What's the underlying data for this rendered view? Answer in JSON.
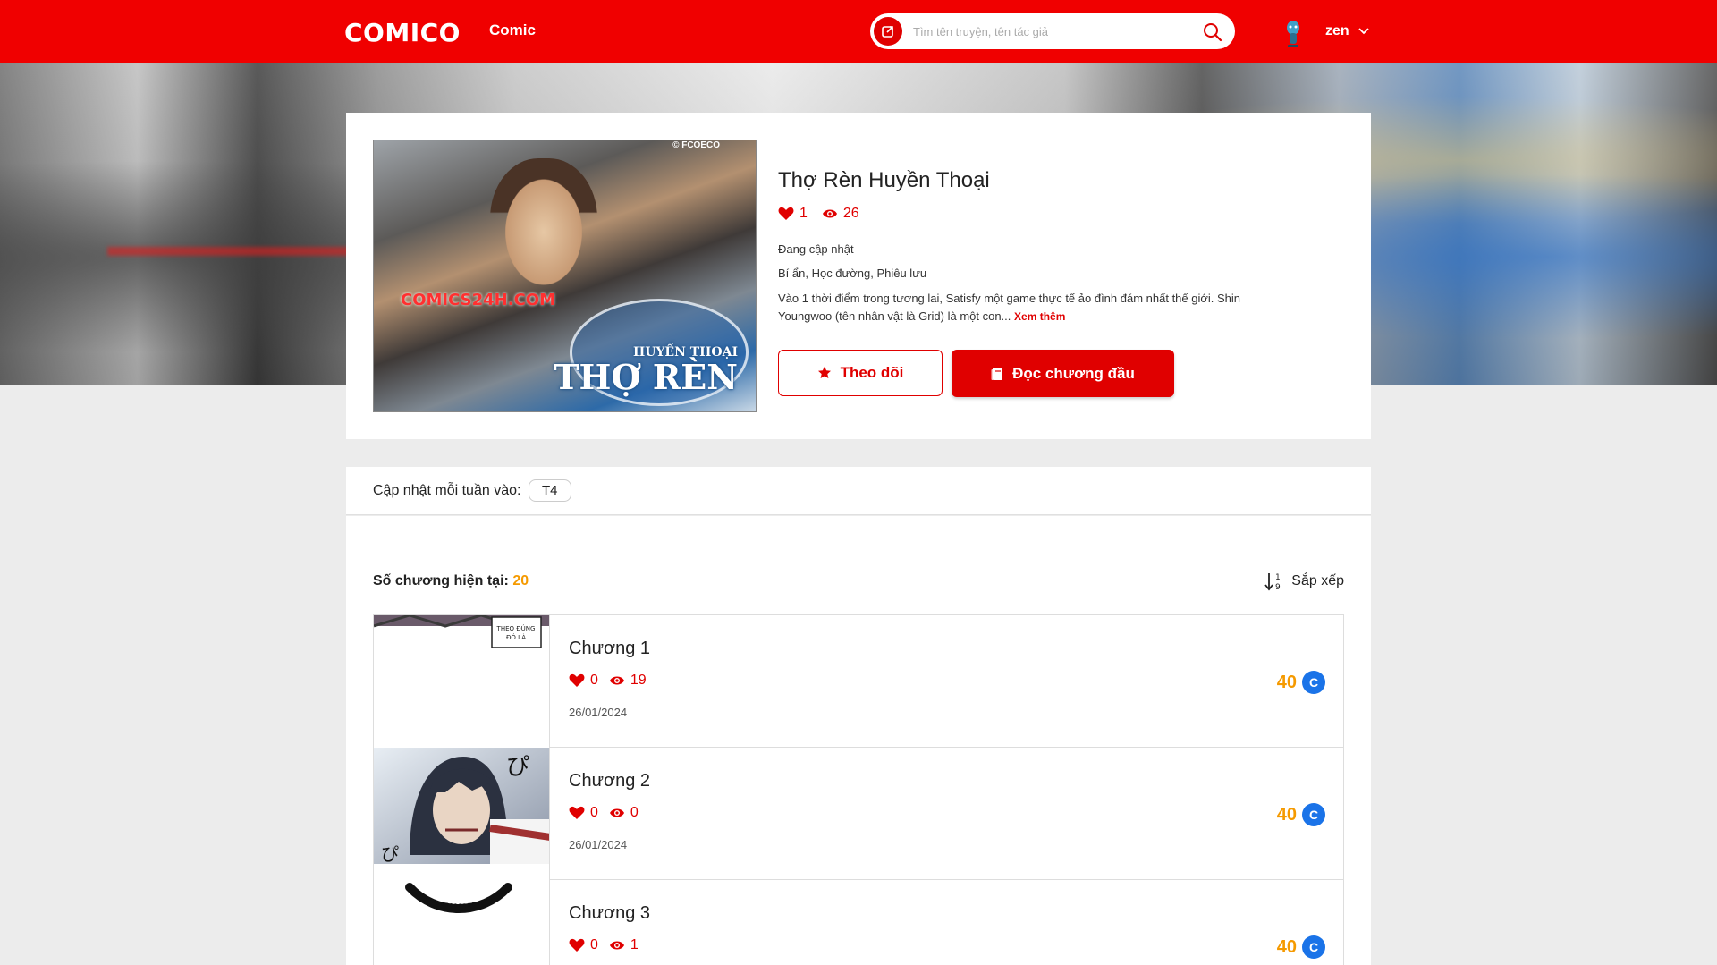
{
  "header": {
    "logo": "COMICO",
    "nav_comic": "Comic",
    "search_placeholder": "Tìm tên truyện, tên tác giả",
    "username": "zen"
  },
  "colors": {
    "brand_red": "#f00000",
    "accent_orange": "#f59a00",
    "coin_blue": "#1a73e8"
  },
  "comic": {
    "title": "Thợ Rèn Huyền Thoại",
    "likes": "1",
    "views": "26",
    "status": "Đang cập nhật",
    "genres": "Bí ẩn, Học đường, Phiêu lưu",
    "description": "Vào 1 thời điểm trong tương lai, Satisfy một game thực tế ảo đình đám nhất thế giới. Shin Youngwoo (tên nhân vật là Grid) là một con...",
    "more_label": "Xem thêm",
    "follow_label": "Theo dõi",
    "read_first_label": "Đọc chương đầu",
    "cover_text": {
      "watermark": "© FCOECO",
      "site": "COMICS24H.COM",
      "title_main": "THỢ RÈN",
      "title_side": "HUYỀN THOẠI"
    }
  },
  "schedule": {
    "label": "Cập nhật mỗi tuần vào:",
    "day": "T4"
  },
  "chapter_list": {
    "count_label": "Số chương hiện tại:",
    "count": "20",
    "sort_label": "Sắp xếp",
    "items": [
      {
        "title": "Chương 1",
        "likes": "0",
        "views": "19",
        "date": "26/01/2024",
        "price": "40",
        "thumb_text": "THEO ĐÚNG ĐÓ LÀ"
      },
      {
        "title": "Chương 2",
        "likes": "0",
        "views": "0",
        "date": "26/01/2024",
        "price": "40",
        "thumb_text": ""
      },
      {
        "title": "Chương 3",
        "likes": "0",
        "views": "1",
        "date": "",
        "price": "40",
        "thumb_text": ""
      }
    ],
    "coin_symbol": "C"
  }
}
